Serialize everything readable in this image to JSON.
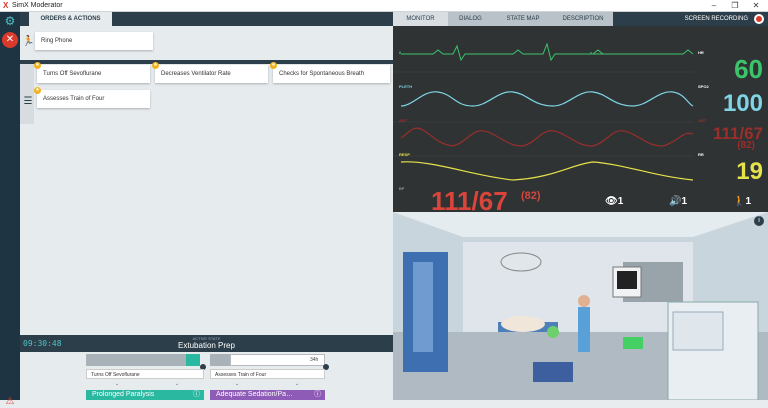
{
  "window": {
    "title": "SimX Moderator",
    "logo": "X",
    "controls": [
      "–",
      "❐",
      "✕"
    ]
  },
  "sidebar": {
    "settings_icon": "gear-icon",
    "close_icon": "x-icon",
    "alert_icon": "warning-icon"
  },
  "left": {
    "tab_label": "ORDERS & ACTIONS",
    "top_card": "Ring Phone",
    "action_cards": [
      "Turns Off Sevoflurane",
      "Decreases Ventilator Rate",
      "Checks for Spontaneous Breath",
      "Assesses Train of Four"
    ],
    "state": {
      "active_label": "ACTIVE STATE",
      "name": "Extubation Prep",
      "timer": "09:30:48"
    },
    "timeline": {
      "items": [
        "Turns Off Sevoflurane",
        "Assesses Train of Four"
      ],
      "time_label": "34h",
      "next_states": [
        {
          "label": "Prolonged Paralysis",
          "color": "#2bb8a0"
        },
        {
          "label": "Adequate Sedation/Pa…",
          "color": "#8e5bb6"
        }
      ]
    }
  },
  "right": {
    "tabs": [
      "MONITOR",
      "DIALOG",
      "STATE MAP",
      "DESCRIPTION"
    ],
    "screen_recording": "SCREEN RECORDING",
    "monitor": {
      "waves": [
        {
          "label": "II",
          "color": "#3cc46b"
        },
        {
          "label": "PLETH",
          "color": "#7fd4e6"
        },
        {
          "label": "ART",
          "color": "#9a2e2a"
        },
        {
          "label": "RESP",
          "color": "#e6e24a"
        }
      ],
      "vitals": [
        {
          "label": "HR",
          "value": "60",
          "color": "#3cc46b"
        },
        {
          "label": "SPO2",
          "value": "100",
          "color": "#7fd4e6"
        },
        {
          "label": "ART",
          "value": "111/67",
          "sub": "(82)",
          "color": "#9a2e2a"
        },
        {
          "label": "RR",
          "value": "19",
          "color": "#e6e24a"
        }
      ],
      "bp": {
        "label": "BP",
        "value": "111/67",
        "mean": "(82)"
      },
      "counters": [
        {
          "icon": "eye-icon",
          "value": "1"
        },
        {
          "icon": "speaker-icon",
          "value": "1"
        },
        {
          "icon": "person-walk-icon",
          "value": "1"
        }
      ]
    },
    "scene_info": "i"
  }
}
